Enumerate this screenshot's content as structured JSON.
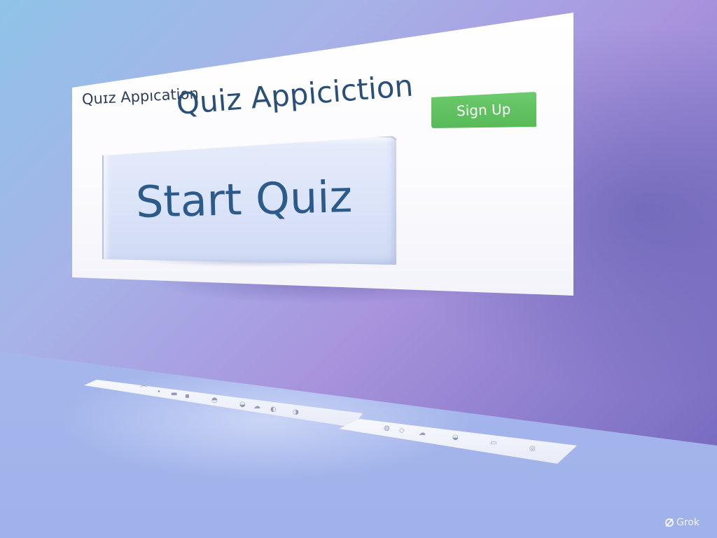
{
  "app": {
    "small_title": "Quɪz Appıcation",
    "main_title": "Quiz Appiciction"
  },
  "header": {
    "signup_label": "Sign Up"
  },
  "main": {
    "start_label": "Start Quiz"
  },
  "trays": {
    "left_icons": [
      "stylus-icon",
      "dot-icon",
      "line-icon",
      "dash-icon",
      "controller-icon",
      "fish-icon",
      "cloud-icon",
      "shell-icon",
      "drop-icon"
    ],
    "right_icons": [
      "badge-icon",
      "tag-icon",
      "cloud-icon",
      "fish-icon",
      "book-icon",
      "seed-icon"
    ]
  },
  "watermark": {
    "label": "Grok"
  },
  "colors": {
    "signup_bg": "#5cbf5c",
    "start_bg": "#dae3f8",
    "title_text": "#2a4f78",
    "start_text": "#2c5a8a"
  }
}
